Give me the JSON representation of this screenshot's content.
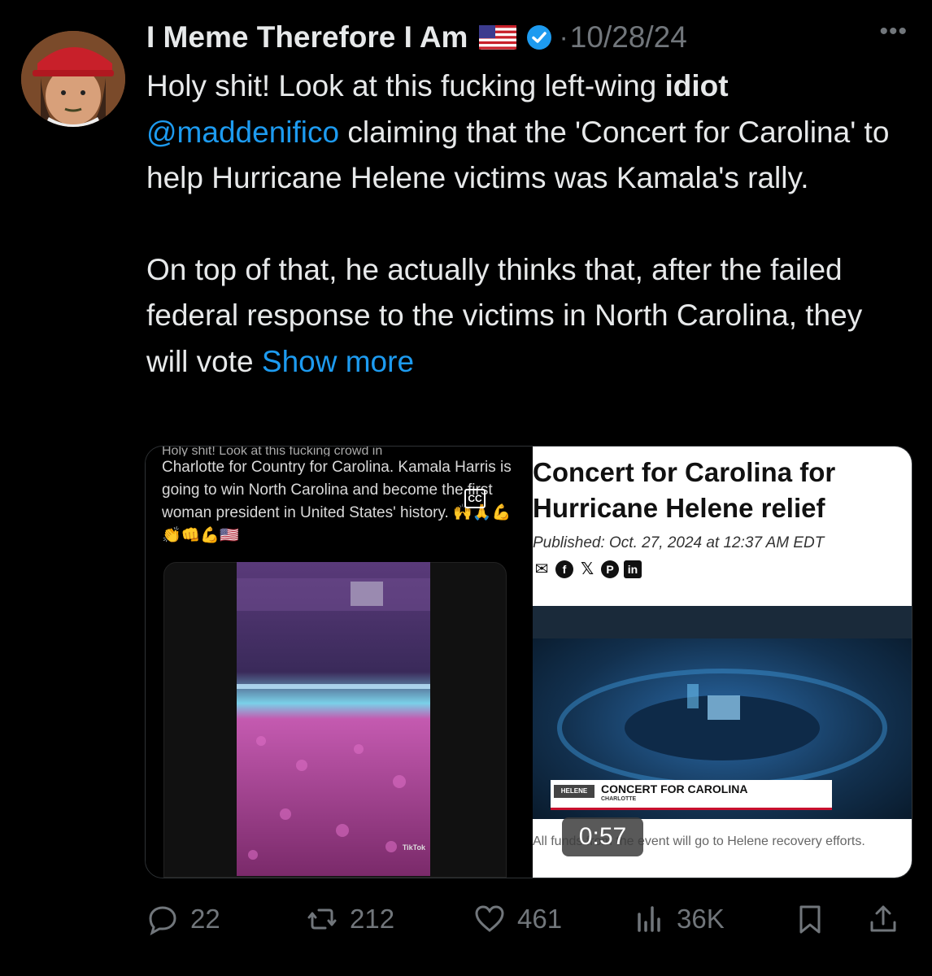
{
  "author": {
    "display_name": "I Meme Therefore I Am",
    "flag_icon": "us-flag-icon",
    "verified_icon": "verified-badge-icon",
    "verified_color": "#1d9bf0",
    "date": "10/28/24",
    "separator": "·",
    "more_label": "•••"
  },
  "tweet": {
    "line1_a": "Holy shit! Look at this fucking left-wing ",
    "line1_bold": "idiot",
    "mention": "@maddenifico",
    "line2_rest": " claiming that the 'Concert for Carolina' to help Hurricane Helene victims was Kamala's rally.",
    "para2": "On top of that, he actually thinks that, after the failed federal response to the victims in North Carolina, they will vote ",
    "show_more": "Show more"
  },
  "media": {
    "left": {
      "caption_cut": "Holy shit! Look at this fucking crowd in",
      "caption": "Charlotte for Country for Carolina. Kamala Harris is going to win North Carolina and become the first woman president in United States' history.",
      "emojis": "🙌🙏💪👏👊💪🇺🇸",
      "cc_label": "CC",
      "tiktok_label": "TikTok"
    },
    "right": {
      "title": "Concert for Carolina for Hurricane Helene relief",
      "published": "Published: Oct. 27, 2024 at 12:37 AM EDT",
      "share_icons": [
        "envelope-icon",
        "facebook-icon",
        "x-icon",
        "pinterest-icon",
        "linkedin-icon"
      ],
      "lower_third_tag": "HELENE",
      "lower_third_title": "CONCERT FOR CAROLINA",
      "lower_third_sub": "CHARLOTTE",
      "footer": "All funds from the event will go to Helene recovery efforts."
    },
    "duration": "0:57"
  },
  "actions": {
    "replies": "22",
    "reposts": "212",
    "likes": "461",
    "views": "36K"
  },
  "colors": {
    "background": "#000000",
    "text": "#e7e9ea",
    "muted": "#71767b",
    "link": "#1d9bf0"
  }
}
